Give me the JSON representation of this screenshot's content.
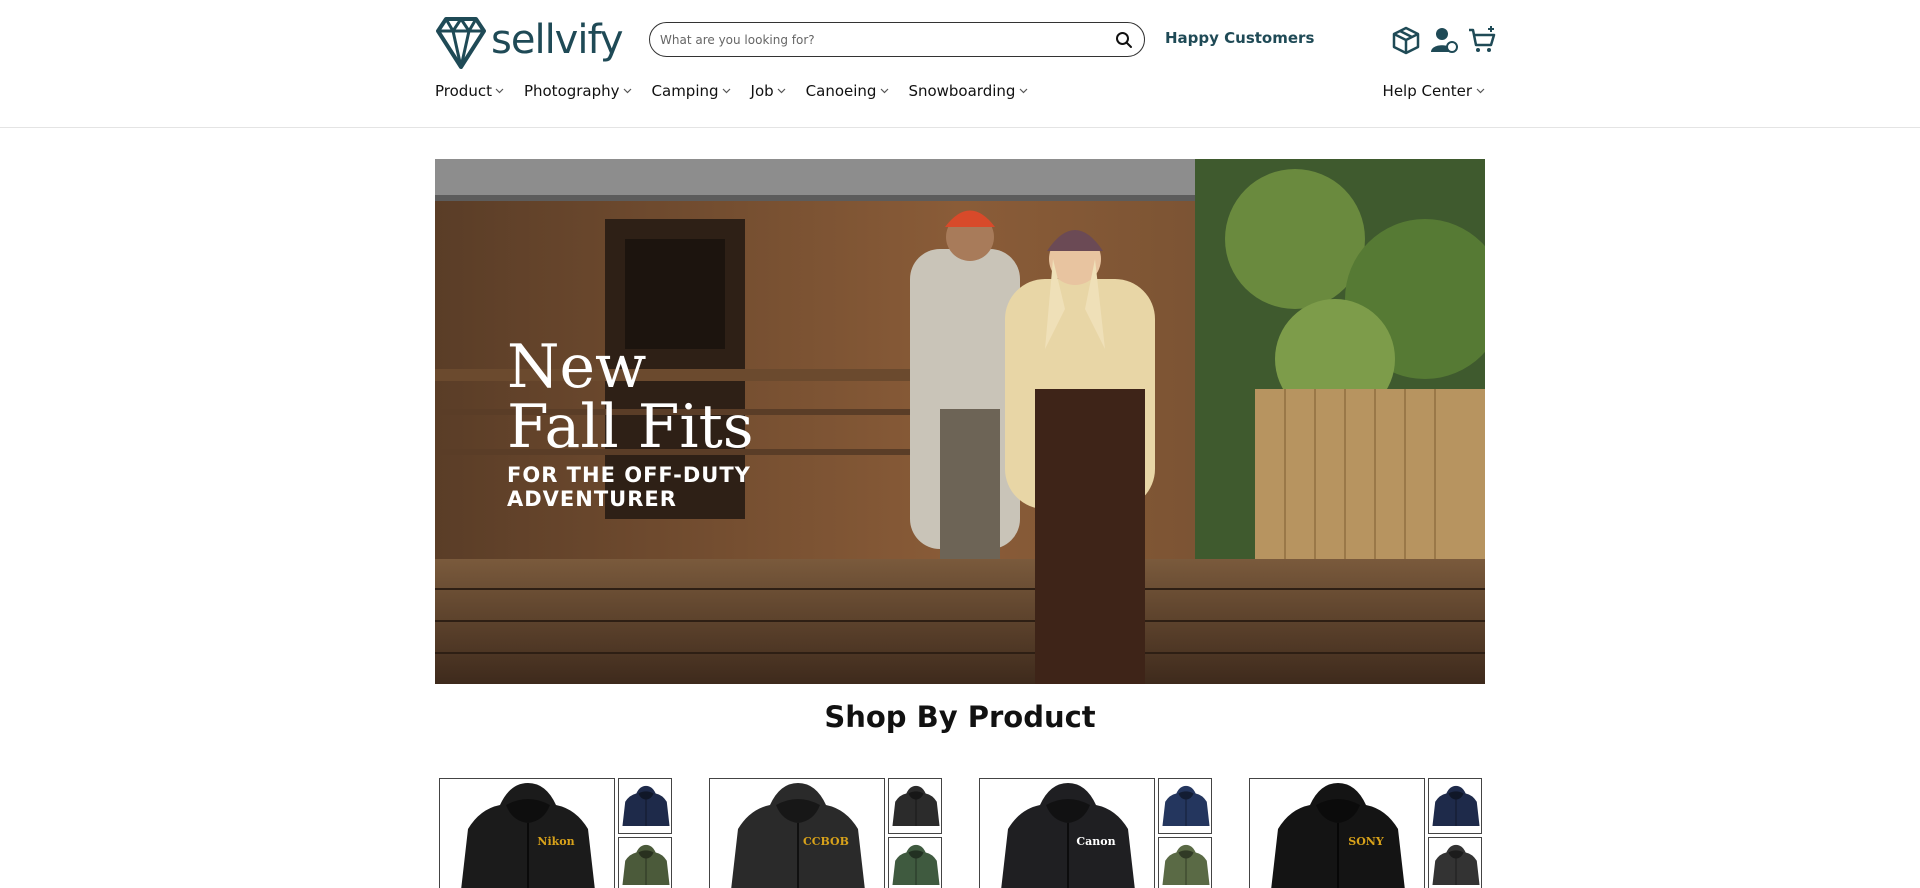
{
  "brand": {
    "name": "sellvify",
    "color": "#1f4a56"
  },
  "search": {
    "placeholder": "What are you looking for?",
    "icon": "search-icon"
  },
  "header": {
    "happy_customers": "Happy Customers",
    "icons": [
      "box-icon",
      "account-icon",
      "cart-icon"
    ]
  },
  "nav": {
    "items": [
      {
        "label": "Product"
      },
      {
        "label": "Photography"
      },
      {
        "label": "Camping"
      },
      {
        "label": "Job"
      },
      {
        "label": "Canoeing"
      },
      {
        "label": "Snowboarding"
      }
    ],
    "help": "Help Center"
  },
  "hero": {
    "line1": "New",
    "line2": "Fall Fits",
    "sub1": "FOR THE OFF-DUTY",
    "sub2": "ADVENTURER"
  },
  "section": {
    "title": "Shop By Product"
  },
  "products": [
    {
      "brand_text": "Nikon",
      "brand_color": "#d8a21a",
      "hood_color": "#1b1b1b",
      "thumb_colors": [
        "#1e2a4a",
        "#4b5a3a"
      ]
    },
    {
      "brand_text": "CCBOB",
      "brand_color": "#d8a21a",
      "hood_color": "#2a2a2a",
      "thumb_colors": [
        "#2b2b2b",
        "#3f5a3f"
      ]
    },
    {
      "brand_text": "Canon",
      "brand_color": "#ffffff",
      "hood_color": "#1f1f22",
      "thumb_colors": [
        "#24365e",
        "#5a6a45"
      ]
    },
    {
      "brand_text": "SONY",
      "brand_color": "#d8a21a",
      "hood_color": "#141414",
      "thumb_colors": [
        "#1e2a4a",
        "#333333"
      ]
    }
  ]
}
